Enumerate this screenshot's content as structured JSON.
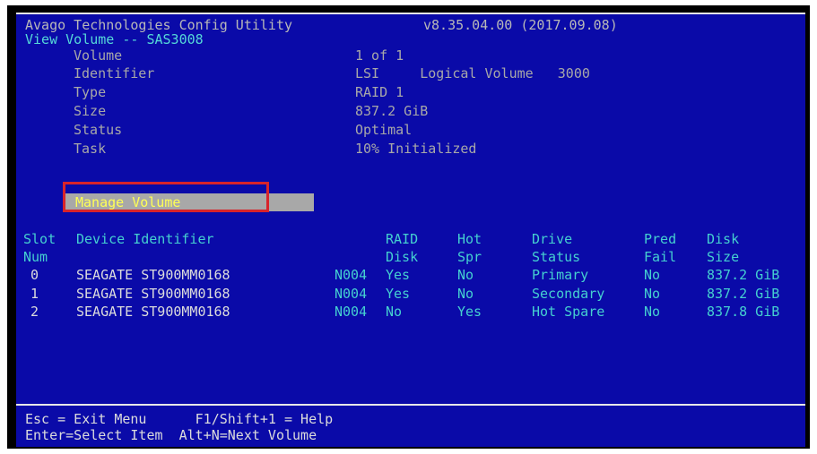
{
  "header": {
    "title": "Avago Technologies Config Utility",
    "version": "v8.35.04.00 (2017.09.08)",
    "subtitle": "View Volume -- SAS3008"
  },
  "volume_info": [
    {
      "label": "Volume",
      "value": "1 of 1"
    },
    {
      "label": "Identifier",
      "value": "LSI     Logical Volume   3000"
    },
    {
      "label": "Type",
      "value": "RAID 1"
    },
    {
      "label": "Size",
      "value": "837.2 GiB"
    },
    {
      "label": "Status",
      "value": "Optimal"
    },
    {
      "label": "Task",
      "value": "10% Initialized"
    }
  ],
  "manage_volume_label": "Manage Volume",
  "table": {
    "headers_line1": {
      "slot": "Slot",
      "device": "Device Identifier",
      "raid": "RAID",
      "hot": "Hot",
      "drive": "Drive",
      "pred": "Pred",
      "disk": "Disk"
    },
    "headers_line2": {
      "slot": "Num",
      "raid": "Disk",
      "hot": "Spr",
      "drive": "Status",
      "pred": "Fail",
      "disk": "Size"
    },
    "rows": [
      {
        "slot": "0",
        "device": "SEAGATE ST900MM0168",
        "rev": "N004",
        "raid": "Yes",
        "hot": "No",
        "drive": "Primary",
        "pred": "No",
        "size": "837.2 GiB"
      },
      {
        "slot": "1",
        "device": "SEAGATE ST900MM0168",
        "rev": "N004",
        "raid": "Yes",
        "hot": "No",
        "drive": "Secondary",
        "pred": "No",
        "size": "837.2 GiB"
      },
      {
        "slot": "2",
        "device": "SEAGATE ST900MM0168",
        "rev": "N004",
        "raid": "No",
        "hot": "Yes",
        "drive": "Hot Spare",
        "pred": "No",
        "size": "837.8 GiB"
      }
    ]
  },
  "footer": {
    "line1": "Esc = Exit Menu      F1/Shift+1 = Help",
    "line2": "Enter=Select Item  Alt+N=Next Volume"
  },
  "colors": {
    "background": "#0a0aa8",
    "text": "#dcdcdc",
    "header_accent": "#45d0d0",
    "selected_bar": "#a8a8a8",
    "selected_text": "#ffff55",
    "highlight_box": "#d8242a"
  }
}
